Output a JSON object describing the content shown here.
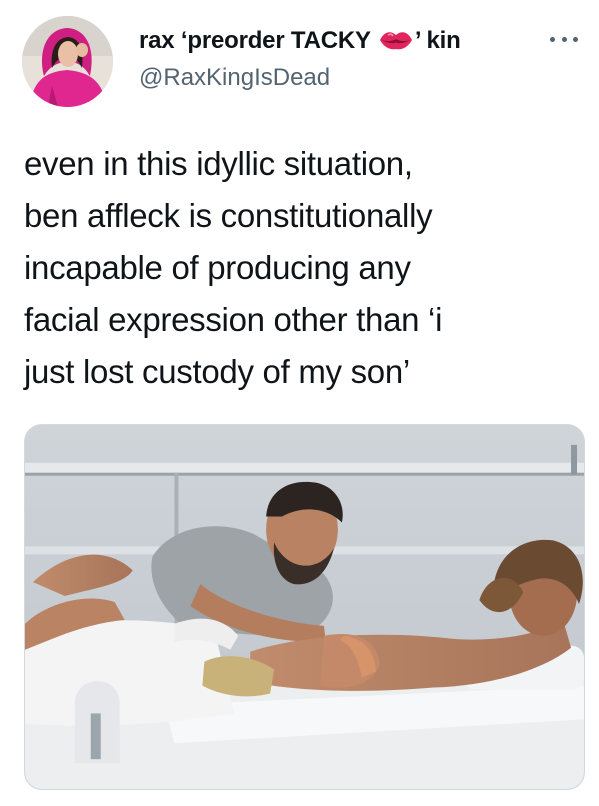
{
  "author": {
    "display_name_before": "rax ‘preorder TACKY",
    "display_name_after": "’ kin",
    "handle": "@RaxKingIsDead",
    "name_emoji": "lips-icon"
  },
  "tweet": {
    "text": "even in this idyllic situation,\nben affleck is constitutionally\nincapable of producing any\nfacial expression other than ‘i\njust lost custody of my son’"
  },
  "icons": {
    "more": "more-icon"
  },
  "colors": {
    "text": "#0f1419",
    "secondary_text": "#536471",
    "avatar_hoodie": "#e0268f",
    "lips": "#e0245e"
  }
}
